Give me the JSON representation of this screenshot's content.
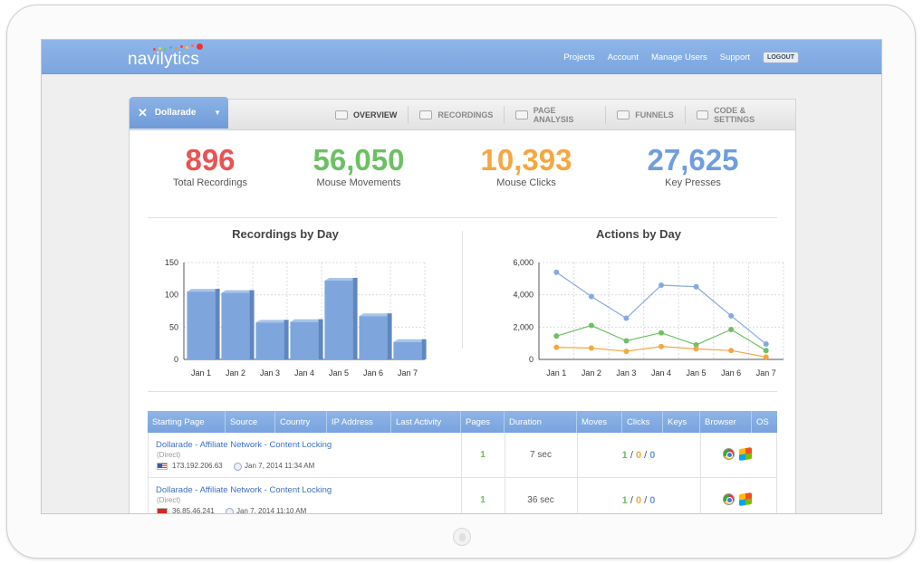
{
  "app": {
    "brand": "navilytics",
    "nav": [
      "Projects",
      "Account",
      "Manage Users",
      "Support"
    ],
    "logout_label": "LOGOUT"
  },
  "project": {
    "name": "Dollarade"
  },
  "tabs": [
    {
      "label": "OVERVIEW",
      "icon": "chart-icon",
      "active": true
    },
    {
      "label": "RECORDINGS",
      "icon": "film-icon",
      "active": false
    },
    {
      "label": "PAGE ANALYSIS",
      "icon": "brain-icon",
      "active": false
    },
    {
      "label": "FUNNELS",
      "icon": "funnel-icon",
      "active": false
    },
    {
      "label": "CODE & SETTINGS",
      "icon": "gear-icon",
      "active": false
    }
  ],
  "stats": [
    {
      "value": "896",
      "label": "Total Recordings",
      "color": "#e95353"
    },
    {
      "value": "56,050",
      "label": "Mouse Movements",
      "color": "#6cc163"
    },
    {
      "value": "10,393",
      "label": "Mouse Clicks",
      "color": "#f5a742"
    },
    {
      "value": "27,625",
      "label": "Key Presses",
      "color": "#6f9ee0"
    }
  ],
  "chart_data": [
    {
      "type": "bar",
      "title": "Recordings by Day",
      "categories": [
        "Jan 1",
        "Jan 2",
        "Jan 3",
        "Jan 4",
        "Jan 5",
        "Jan 6",
        "Jan 7"
      ],
      "values": [
        105,
        103,
        57,
        58,
        122,
        67,
        27
      ],
      "ylim": [
        0,
        150
      ],
      "yticks": [
        "0",
        "50",
        "100",
        "150"
      ],
      "color": "#7fa6dc",
      "grid": true
    },
    {
      "type": "line",
      "title": "Actions by Day",
      "categories": [
        "Jan 1",
        "Jan 2",
        "Jan 3",
        "Jan 4",
        "Jan 5",
        "Jan 6",
        "Jan 7"
      ],
      "ylim": [
        0,
        6000
      ],
      "yticks": [
        "0",
        "2,000",
        "4,000",
        "6,000"
      ],
      "series": [
        {
          "values": [
            5400,
            3900,
            2550,
            4600,
            4500,
            2700,
            950
          ],
          "color": "#86a9e0"
        },
        {
          "values": [
            1450,
            2100,
            1150,
            1650,
            900,
            1850,
            550
          ],
          "color": "#6cc163"
        },
        {
          "values": [
            750,
            700,
            500,
            800,
            650,
            550,
            150
          ],
          "color": "#f5a742"
        }
      ],
      "grid": true
    }
  ],
  "table": {
    "headers": [
      {
        "label": "Starting Page",
        "w": 86
      },
      {
        "label": "Source",
        "w": 55
      },
      {
        "label": "Country",
        "w": 57
      },
      {
        "label": "IP Address",
        "w": 71
      },
      {
        "label": "Last Activity",
        "w": 77
      },
      {
        "label": "Pages",
        "w": 48
      },
      {
        "label": "Duration",
        "w": 80
      },
      {
        "label": "Moves",
        "w": 50
      },
      {
        "label": "Clicks",
        "w": 45
      },
      {
        "label": "Keys",
        "w": 41
      },
      {
        "label": "Browser",
        "w": 57
      },
      {
        "label": "OS",
        "w": 28
      }
    ],
    "rows": [
      {
        "page": "Dollarade - Affiliate Network - Content Locking",
        "source": "(Direct)",
        "ip": "173.192.206.63",
        "flag": "us",
        "last": "Jan 7, 2014 11:34 AM",
        "pages": "1",
        "duration": "7 sec",
        "moves": "1",
        "clicks": "0",
        "keys": "0"
      },
      {
        "page": "Dollarade - Affiliate Network - Content Locking",
        "source": "(Direct)",
        "ip": "36.85.46.241",
        "flag": "cn",
        "last": "Jan 7, 2014 11:10 AM",
        "pages": "1",
        "duration": "36 sec",
        "moves": "1",
        "clicks": "0",
        "keys": "0"
      }
    ]
  }
}
